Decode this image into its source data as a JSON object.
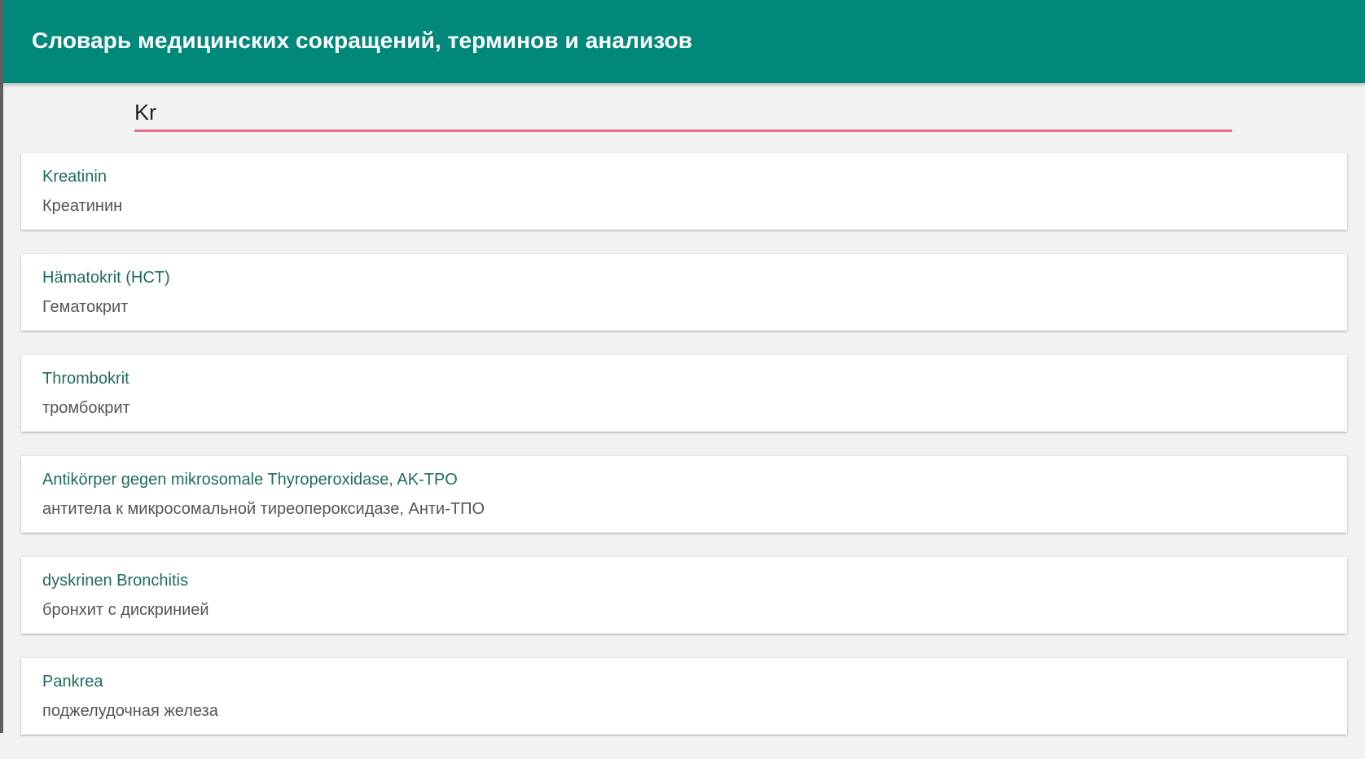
{
  "app_bar": {
    "title": "Словарь медицинских сокращений, терминов и анализов"
  },
  "search": {
    "value": "Kr",
    "placeholder": ""
  },
  "colors": {
    "primary": "#00897b",
    "accent": "#e57390",
    "term_text": "#1f6b5e",
    "translation_text": "#555555"
  },
  "results": [
    {
      "term": "Kreatinin",
      "translation": "Креатинин"
    },
    {
      "term": "Hämatokrit (HCT)",
      "translation": "Гематокрит"
    },
    {
      "term": "Thrombokrit",
      "translation": "тромбокрит"
    },
    {
      "term": "Antikörper gegen mikrosomale Thyroperoxidase, AK-TPO",
      "translation": "антитела к микросомальной тиреопероксидазе, Анти-ТПО"
    },
    {
      "term": "dyskrinen Bronchitis",
      "translation": "бронхит с дискринией"
    },
    {
      "term": "Pankrea",
      "translation": "поджелудочная железа"
    }
  ]
}
